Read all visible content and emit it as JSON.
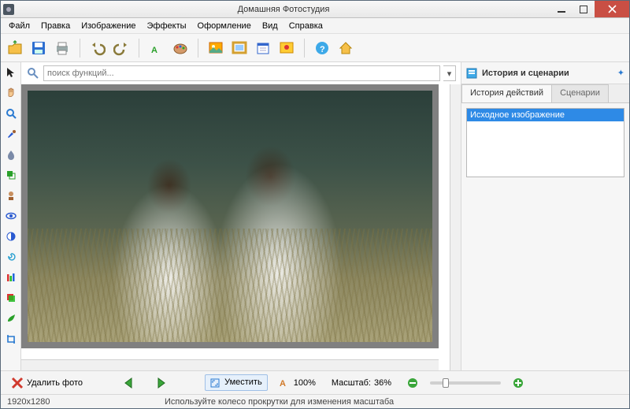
{
  "window": {
    "title": "Домашняя Фотостудия"
  },
  "menu": {
    "file": "Файл",
    "edit": "Правка",
    "image": "Изображение",
    "effects": "Эффекты",
    "decor": "Оформление",
    "view": "Вид",
    "help": "Справка"
  },
  "search": {
    "placeholder": "поиск функций..."
  },
  "right_panel": {
    "title": "История и сценарии",
    "tab_history": "История действий",
    "tab_scenarios": "Сценарии",
    "item_source": "Исходное изображение"
  },
  "bottom": {
    "delete_photo": "Удалить фото",
    "fit": "Уместить",
    "zoom_text": "100%",
    "scale_label": "Масштаб:",
    "scale_value": "36%"
  },
  "status": {
    "dimensions": "1920x1280",
    "hint": "Используйте колесо прокрутки для изменения масштаба"
  },
  "colors": {
    "accent": "#2e8ae6",
    "close": "#c94f44"
  }
}
